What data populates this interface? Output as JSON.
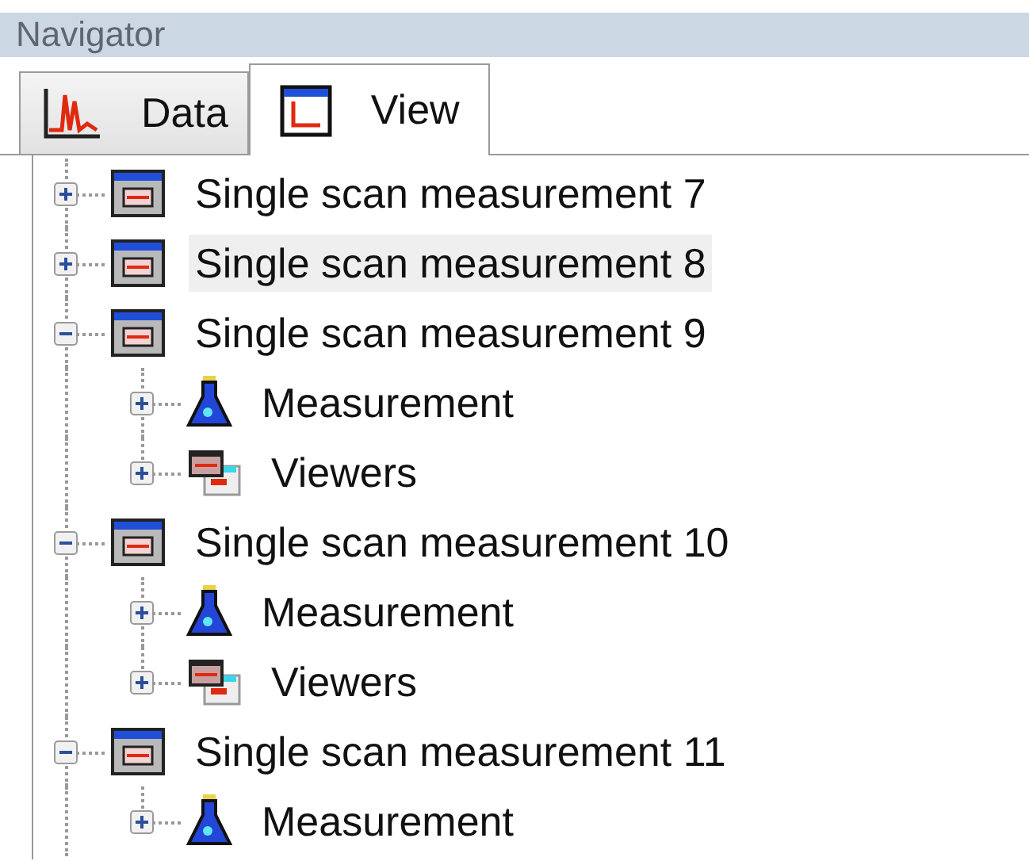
{
  "panel": {
    "title": "Navigator"
  },
  "tabs": [
    {
      "label": "Data",
      "kind": "data",
      "selected": false
    },
    {
      "label": "View",
      "kind": "view",
      "selected": true
    }
  ],
  "tree": [
    {
      "label": "Single scan measurement 7",
      "kind": "scan",
      "expanded": false,
      "selected": false
    },
    {
      "label": "Single scan measurement 8",
      "kind": "scan",
      "expanded": false,
      "selected": true
    },
    {
      "label": "Single scan measurement 9",
      "kind": "scan",
      "expanded": true,
      "selected": false,
      "children": [
        {
          "label": "Measurement",
          "kind": "measurement",
          "expanded": false,
          "selected": false
        },
        {
          "label": "Viewers",
          "kind": "viewers",
          "expanded": false,
          "selected": false
        }
      ]
    },
    {
      "label": "Single scan measurement 10",
      "kind": "scan",
      "expanded": true,
      "selected": false,
      "children": [
        {
          "label": "Measurement",
          "kind": "measurement",
          "expanded": false,
          "selected": false
        },
        {
          "label": "Viewers",
          "kind": "viewers",
          "expanded": false,
          "selected": false
        }
      ]
    },
    {
      "label": "Single scan measurement 11",
      "kind": "scan",
      "expanded": true,
      "selected": false,
      "children": [
        {
          "label": "Measurement",
          "kind": "measurement",
          "expanded": false,
          "selected": false
        }
      ]
    }
  ]
}
